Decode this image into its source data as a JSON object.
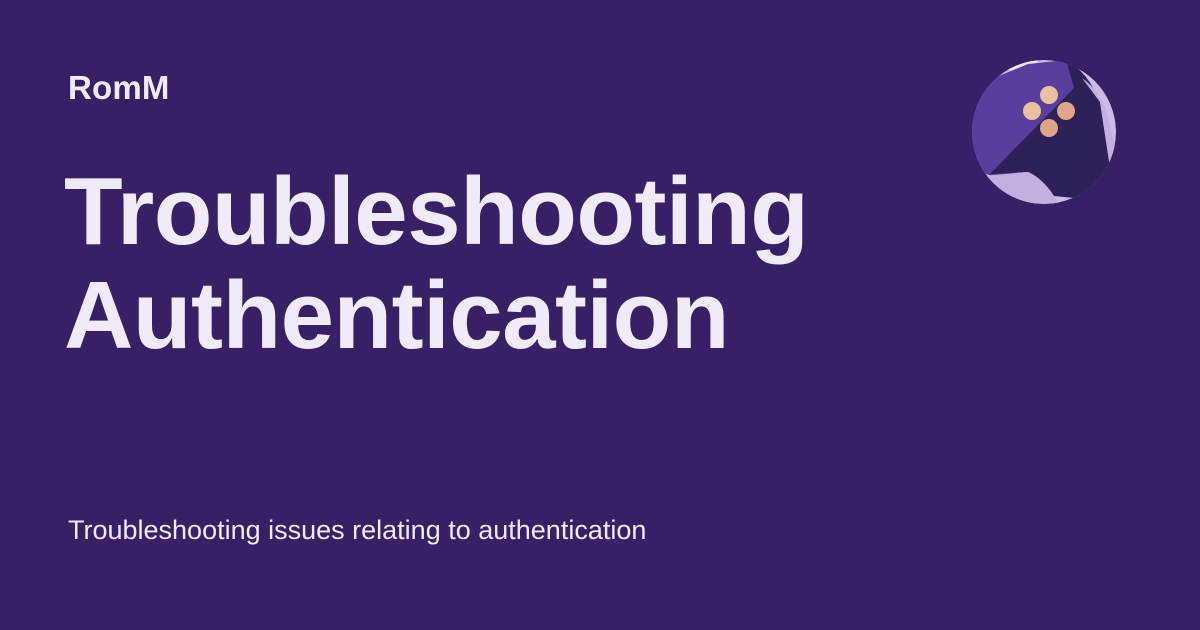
{
  "site": {
    "name": "RomM"
  },
  "page": {
    "title_line1": "Troubleshooting",
    "title_line2": "Authentication",
    "description": "Troubleshooting issues relating to authentication"
  },
  "logo": {
    "icon": "romm-gamepad-logo-icon"
  },
  "colors": {
    "background": "#382067",
    "text": "#F1EAFB",
    "logo_light": "#C9B7E6",
    "logo_mid": "#5A3E9E",
    "logo_dark": "#2E2158",
    "button_a": "#E8C1A0",
    "button_b": "#E0A48A"
  }
}
